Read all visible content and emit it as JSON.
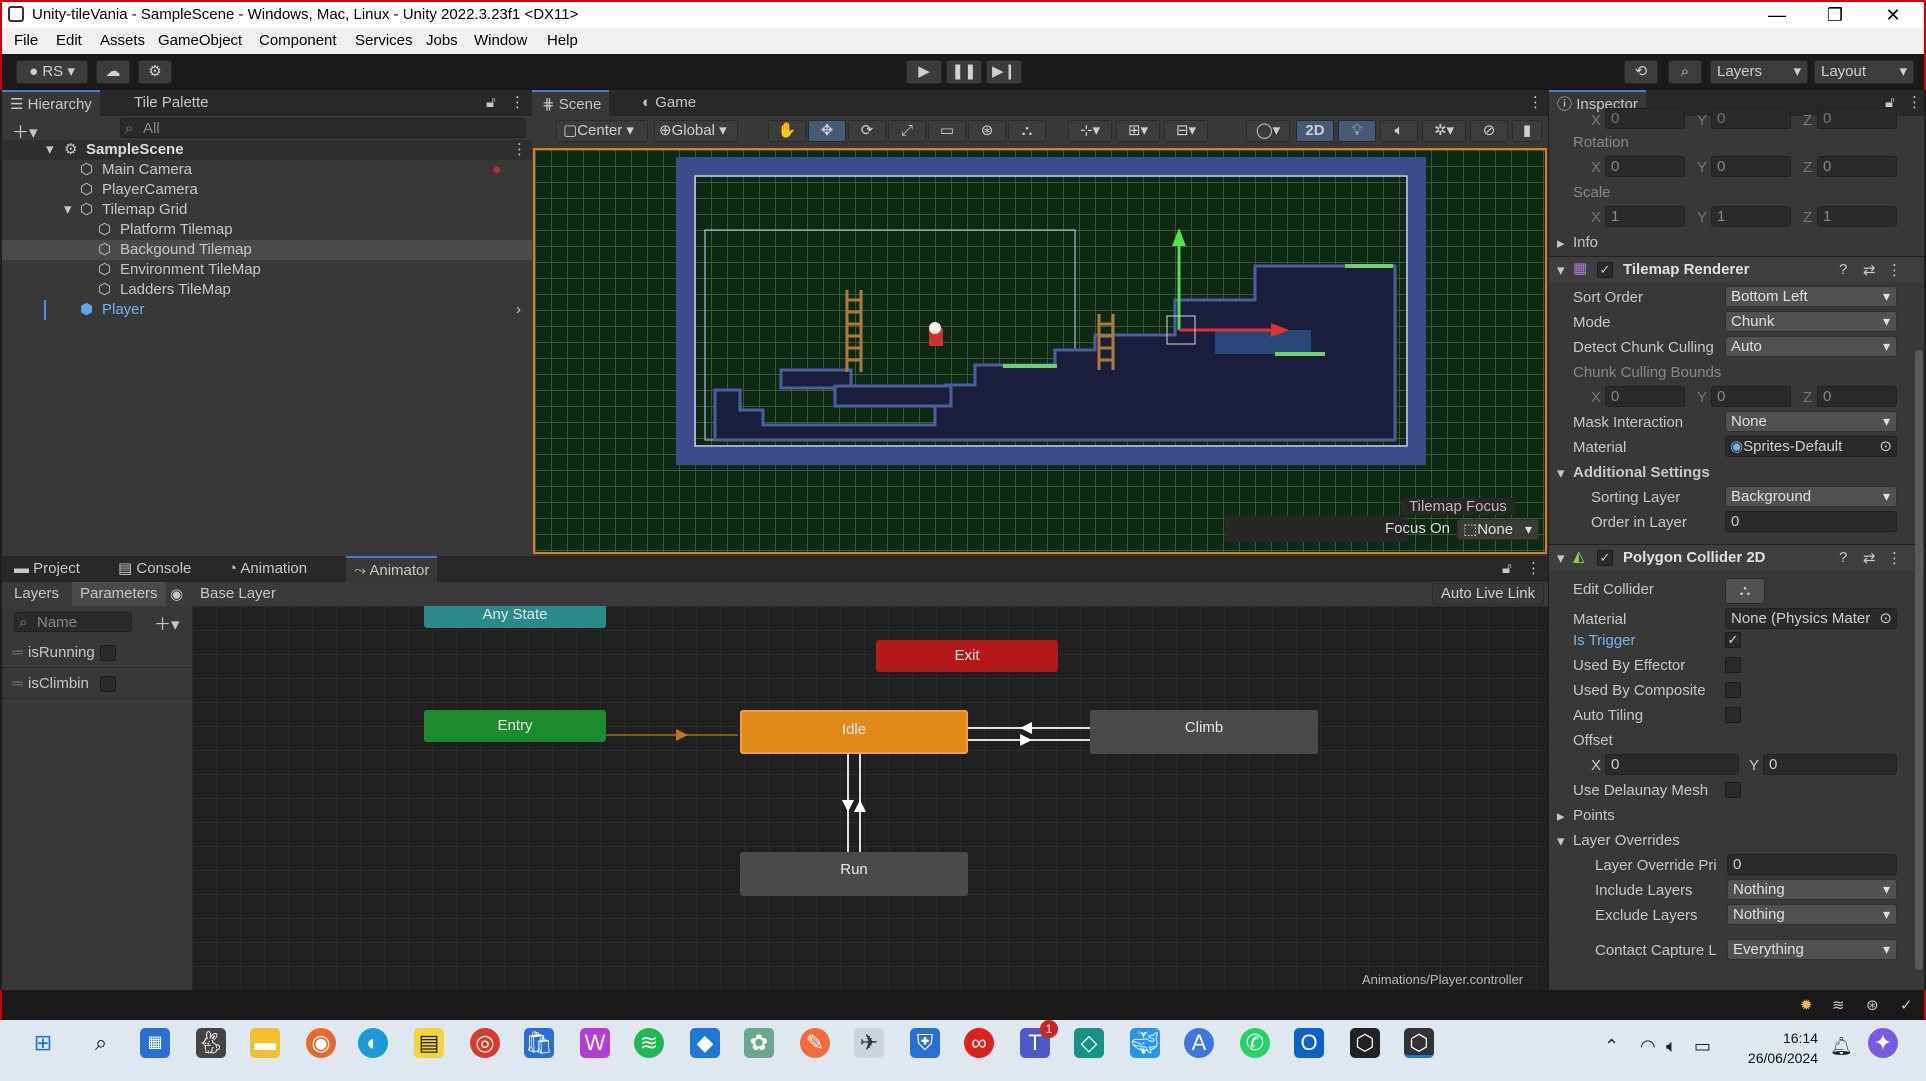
{
  "title_bar": {
    "title": "Unity-tileVania - SampleScene - Windows, Mac, Linux - Unity 2022.3.23f1 <DX11>",
    "minimize": "—",
    "maximize": "❐",
    "close": "✕"
  },
  "menu": [
    "File",
    "Edit",
    "Assets",
    "GameObject",
    "Component",
    "Services",
    "Jobs",
    "Window",
    "Help"
  ],
  "toolbar": {
    "account": "RS",
    "layers_label": "Layers",
    "layout_label": "Layout"
  },
  "hierarchy": {
    "tabs": [
      "Hierarchy",
      "Tile Palette"
    ],
    "search_placeholder": "All",
    "scene": "SampleScene",
    "items": [
      "Main Camera",
      "PlayerCamera",
      "Tilemap Grid",
      "Platform Tilemap",
      "Backgound Tilemap",
      "Environment TileMap",
      "Ladders TileMap",
      "Player"
    ]
  },
  "scene_view": {
    "tabs": [
      "Scene",
      "Game"
    ],
    "pivot": "Center",
    "space": "Global",
    "mode_2d": "2D",
    "overlay_title": "Tilemap Focus",
    "focus_label": "Focus On",
    "focus_value": "None"
  },
  "bottom": {
    "tabs": [
      "Project",
      "Console",
      "Animation",
      "Animator"
    ],
    "sub_tabs": [
      "Layers",
      "Parameters"
    ],
    "layer_name": "Base Layer",
    "auto_live_link": "Auto Live Link",
    "name_placeholder": "Name",
    "params": [
      "isRunning",
      "isClimbin"
    ],
    "states": {
      "any_state": "Any State",
      "entry": "Entry",
      "exit": "Exit",
      "idle": "Idle",
      "climb": "Climb",
      "run": "Run"
    },
    "path": "Animations/Player.controller"
  },
  "inspector": {
    "tab": "Inspector",
    "position": {
      "x": "0",
      "y": "0",
      "z": "0"
    },
    "rotation_label": "Rotation",
    "rotation": {
      "x": "0",
      "y": "0",
      "z": "0"
    },
    "scale_label": "Scale",
    "scale": {
      "x": "1",
      "y": "1",
      "z": "1"
    },
    "info_label": "Info",
    "tilemap_renderer": {
      "title": "Tilemap Renderer",
      "sort_order_label": "Sort Order",
      "sort_order": "Bottom Left",
      "mode_label": "Mode",
      "mode": "Chunk",
      "detect_label": "Detect Chunk Culling",
      "detect": "Auto",
      "bounds_label": "Chunk Culling Bounds",
      "bounds": {
        "x": "0",
        "y": "0",
        "z": "0"
      },
      "mask_label": "Mask Interaction",
      "mask": "None",
      "material_label": "Material",
      "material": "Sprites-Default",
      "additional_label": "Additional Settings",
      "sorting_layer_label": "Sorting Layer",
      "sorting_layer": "Background",
      "order_label": "Order in Layer",
      "order": "0"
    },
    "polygon_collider": {
      "title": "Polygon Collider 2D",
      "edit_label": "Edit Collider",
      "material_label": "Material",
      "material": "None (Physics Mater",
      "is_trigger_label": "Is Trigger",
      "effector_label": "Used By Effector",
      "composite_label": "Used By Composite",
      "tiling_label": "Auto Tiling",
      "offset_label": "Offset",
      "offset": {
        "x": "0",
        "y": "0"
      },
      "delaunay_label": "Use Delaunay Mesh",
      "points_label": "Points",
      "overrides_label": "Layer Overrides",
      "priority_label": "Layer Override Pri",
      "priority": "0",
      "include_label": "Include Layers",
      "include": "Nothing",
      "exclude_label": "Exclude Layers",
      "exclude": "Nothing",
      "capture_label": "Contact Capture L",
      "capture": "Everything"
    }
  },
  "taskbar": {
    "time": "16:14",
    "date": "26/06/2024",
    "notification_badge": "1"
  }
}
